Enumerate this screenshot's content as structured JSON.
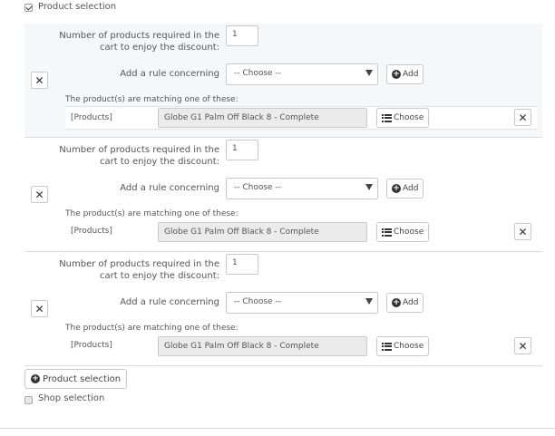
{
  "product_selection": {
    "checkbox_label": "Product selection",
    "checked": true,
    "groups": [
      {
        "quantity_label_line1": "Number of products required in the",
        "quantity_label_line2": "cart to enjoy the discount:",
        "quantity_value": "1",
        "rule_label": "Add a rule concerning",
        "rule_select_value": "-- Choose --",
        "add_button_label": "Add",
        "matching_label": "The product(s) are matching one of these:",
        "rule_type_label": "[Products]",
        "product_value": "Globe G1 Palm Off Black 8 - Complete",
        "choose_button_label": "Choose"
      },
      {
        "quantity_label_line1": "Number of products required in the",
        "quantity_label_line2": "cart to enjoy the discount:",
        "quantity_value": "1",
        "rule_label": "Add a rule concerning",
        "rule_select_value": "-- Choose --",
        "add_button_label": "Add",
        "matching_label": "The product(s) are matching one of these:",
        "rule_type_label": "[Products]",
        "product_value": "Globe G1 Palm Off Black 8 - Complete",
        "choose_button_label": "Choose"
      },
      {
        "quantity_label_line1": "Number of products required in the",
        "quantity_label_line2": "cart to enjoy the discount:",
        "quantity_value": "1",
        "rule_label": "Add a rule concerning",
        "rule_select_value": "-- Choose --",
        "add_button_label": "Add",
        "matching_label": "The product(s) are matching one of these:",
        "rule_type_label": "[Products]",
        "product_value": "Globe G1 Palm Off Black 8 - Complete",
        "choose_button_label": "Choose"
      }
    ],
    "add_group_button_label": "Product selection"
  },
  "shop_selection": {
    "checkbox_label": "Shop selection",
    "checked": false
  },
  "icons": {
    "remove": "close-icon",
    "add": "plus-circle-icon",
    "choose": "list-icon"
  }
}
